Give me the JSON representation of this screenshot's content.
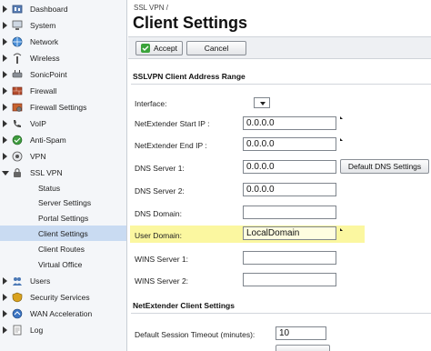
{
  "sidebar": {
    "items": [
      {
        "label": "Dashboard",
        "icon": "dashboard-icon"
      },
      {
        "label": "System",
        "icon": "system-icon"
      },
      {
        "label": "Network",
        "icon": "network-icon"
      },
      {
        "label": "Wireless",
        "icon": "wireless-icon"
      },
      {
        "label": "SonicPoint",
        "icon": "sonicpoint-icon"
      },
      {
        "label": "Firewall",
        "icon": "firewall-icon"
      },
      {
        "label": "Firewall Settings",
        "icon": "firewall-settings-icon"
      },
      {
        "label": "VoIP",
        "icon": "voip-icon"
      },
      {
        "label": "Anti-Spam",
        "icon": "anti-spam-icon"
      },
      {
        "label": "VPN",
        "icon": "vpn-icon"
      },
      {
        "label": "SSL VPN",
        "icon": "ssl-vpn-icon"
      }
    ],
    "ssl_vpn_children": [
      {
        "label": "Status"
      },
      {
        "label": "Server Settings"
      },
      {
        "label": "Portal Settings"
      },
      {
        "label": "Client Settings",
        "selected": true
      },
      {
        "label": "Client Routes"
      },
      {
        "label": "Virtual Office"
      }
    ],
    "items_after": [
      {
        "label": "Users",
        "icon": "users-icon"
      },
      {
        "label": "Security Services",
        "icon": "security-services-icon"
      },
      {
        "label": "WAN Acceleration",
        "icon": "wan-acceleration-icon"
      },
      {
        "label": "Log",
        "icon": "log-icon"
      }
    ]
  },
  "header": {
    "breadcrumb": "SSL VPN /",
    "title": "Client Settings"
  },
  "toolbar": {
    "accept_label": "Accept",
    "cancel_label": "Cancel"
  },
  "address_range": {
    "heading": "SSLVPN Client Address Range",
    "interface_label": "Interface:",
    "interface_value": "",
    "start_ip_label": "NetExtender Start IP :",
    "start_ip_value": "0.0.0.0",
    "end_ip_label": "NetExtender End IP :",
    "end_ip_value": "0.0.0.0",
    "dns1_label": "DNS Server 1:",
    "dns1_value": "0.0.0.0",
    "default_dns_label": "Default DNS Settings",
    "dns2_label": "DNS Server 2:",
    "dns2_value": "0.0.0.0",
    "dns_domain_label": "DNS Domain:",
    "dns_domain_value": "",
    "user_domain_label": "User Domain:",
    "user_domain_value": "LocalDomain",
    "wins1_label": "WINS Server 1:",
    "wins1_value": "",
    "wins2_label": "WINS Server 2:",
    "wins2_value": ""
  },
  "client_settings": {
    "heading": "NetExtender Client Settings",
    "timeout_label": "Default Session Timeout (minutes):",
    "timeout_value": "10"
  },
  "colors": {
    "highlight": "#fbf7a0",
    "selected_nav": "#c9dbf2",
    "accept_check": "#3aa33a"
  }
}
